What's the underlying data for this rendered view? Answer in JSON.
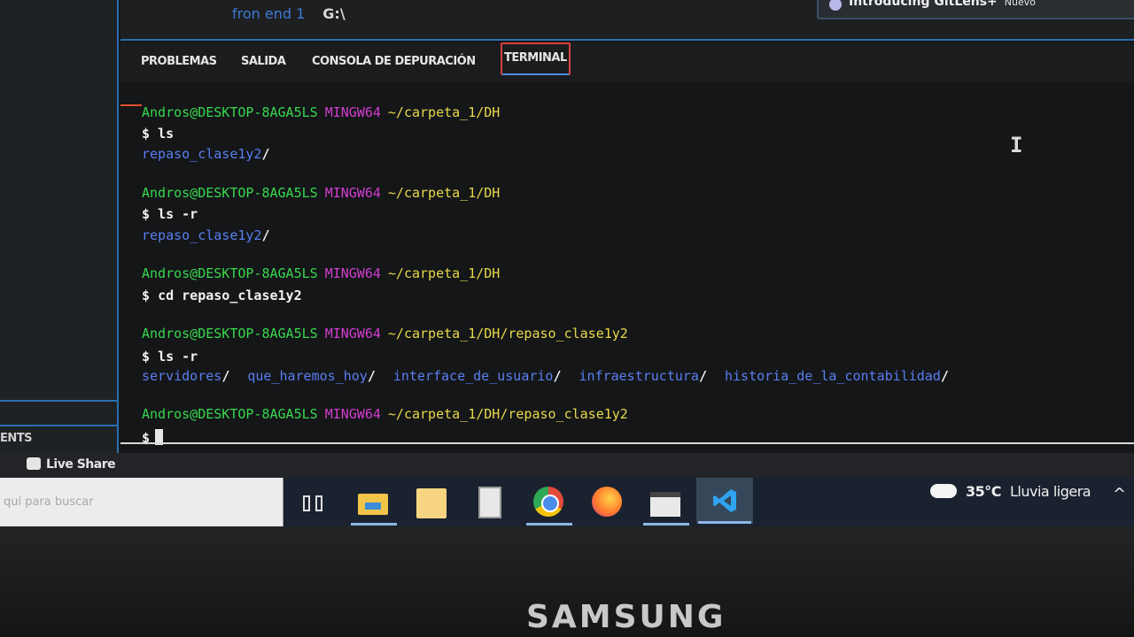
{
  "editor": {
    "line1_text": "fron end 1",
    "line1_drive": "G:\\"
  },
  "notification": {
    "title": "Introducing GitLens+",
    "badge": "Nuevo"
  },
  "sidebar": {
    "section_label": "ENTS"
  },
  "panel": {
    "tabs": [
      {
        "label": "PROBLEMAS"
      },
      {
        "label": "SALIDA"
      },
      {
        "label": "CONSOLA DE DEPURACIÓN"
      },
      {
        "label": "TERMINAL"
      }
    ],
    "active_tab": "TERMINAL"
  },
  "terminal": {
    "user_host": "Andros@DESKTOP-8AGA5LS",
    "system": "MINGW64",
    "prompt_symbol": "$",
    "blocks": [
      {
        "path": "~/carpeta_1/DH",
        "command": "ls",
        "output": [
          "repaso_clase1y2"
        ]
      },
      {
        "path": "~/carpeta_1/DH",
        "command": "ls -r",
        "output": [
          "repaso_clase1y2"
        ]
      },
      {
        "path": "~/carpeta_1/DH",
        "command": "cd repaso_clase1y2",
        "output": []
      },
      {
        "path": "~/carpeta_1/DH/repaso_clase1y2",
        "command": "ls -r",
        "output": [
          "servidores",
          "que_haremos_hoy",
          "interface_de_usuario",
          "infraestructura",
          "historia_de_la_contabilidad"
        ]
      },
      {
        "path": "~/carpeta_1/DH/repaso_clase1y2",
        "command": "",
        "output": []
      }
    ]
  },
  "statusbar": {
    "live_share": "Live Share"
  },
  "taskbar": {
    "search_placeholder": "quí para buscar",
    "weather_temp": "35°C",
    "weather_condition": "Lluvia ligera",
    "icons": [
      "task-view-icon",
      "file-explorer-icon",
      "sticky-notes-icon",
      "calculator-icon",
      "chrome-icon",
      "firefox-icon",
      "video-editor-icon",
      "vscode-icon"
    ]
  },
  "monitor": {
    "brand": "SAMSUNG"
  },
  "colors": {
    "user": "#39d84e",
    "system": "#d23ed0",
    "path": "#e9d94a",
    "dir": "#5a7ff0",
    "active_tab_border": "#d84040"
  }
}
